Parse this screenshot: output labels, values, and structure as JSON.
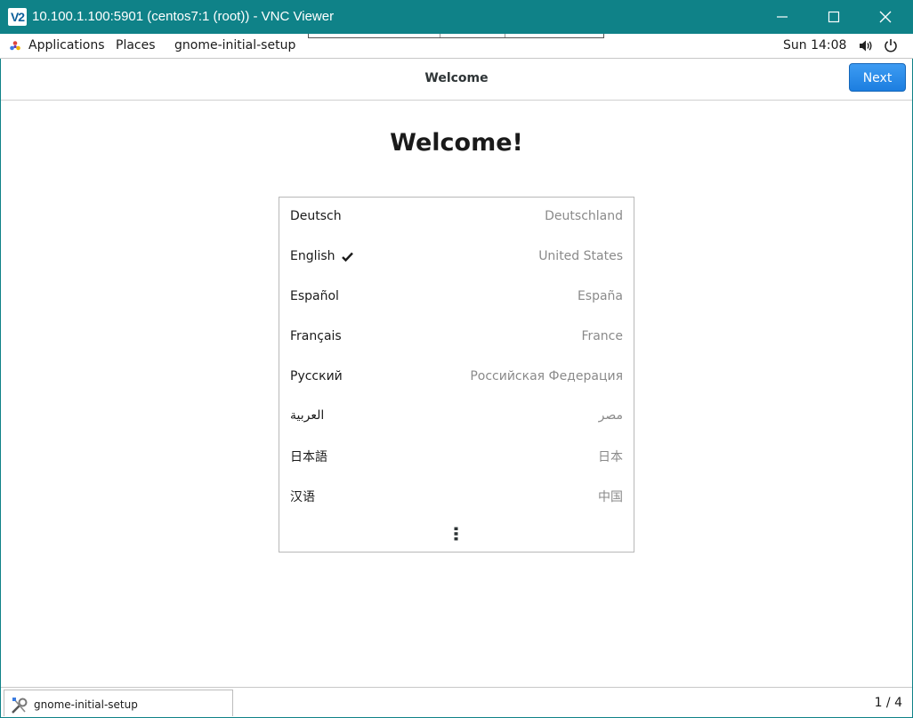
{
  "vnc_window": {
    "logo": "V2",
    "title": "10.100.1.100:5901 (centos7:1 (root)) - VNC Viewer",
    "accent_color": "#0f8288"
  },
  "top_bar": {
    "applications": "Applications",
    "places": "Places",
    "app_menu": "gnome-initial-setup",
    "clock": "Sun 14:08"
  },
  "header": {
    "title": "Welcome",
    "next_label": "Next",
    "next_color": "#1c7ee0"
  },
  "main": {
    "title": "Welcome!",
    "languages": [
      {
        "name": "Deutsch",
        "country": "Deutschland",
        "selected": false
      },
      {
        "name": "English",
        "country": "United States",
        "selected": true
      },
      {
        "name": "Español",
        "country": "España",
        "selected": false
      },
      {
        "name": "Français",
        "country": "France",
        "selected": false
      },
      {
        "name": "Русский",
        "country": "Российская Федерация",
        "selected": false
      },
      {
        "name": "العربية",
        "country": "مصر",
        "selected": false
      },
      {
        "name": "日本語",
        "country": "日本",
        "selected": false
      },
      {
        "name": "汉语",
        "country": "中国",
        "selected": false
      }
    ],
    "more_icon": "vertical-ellipsis-icon"
  },
  "taskbar": {
    "task_label": "gnome-initial-setup",
    "workspace": "1 / 4"
  }
}
